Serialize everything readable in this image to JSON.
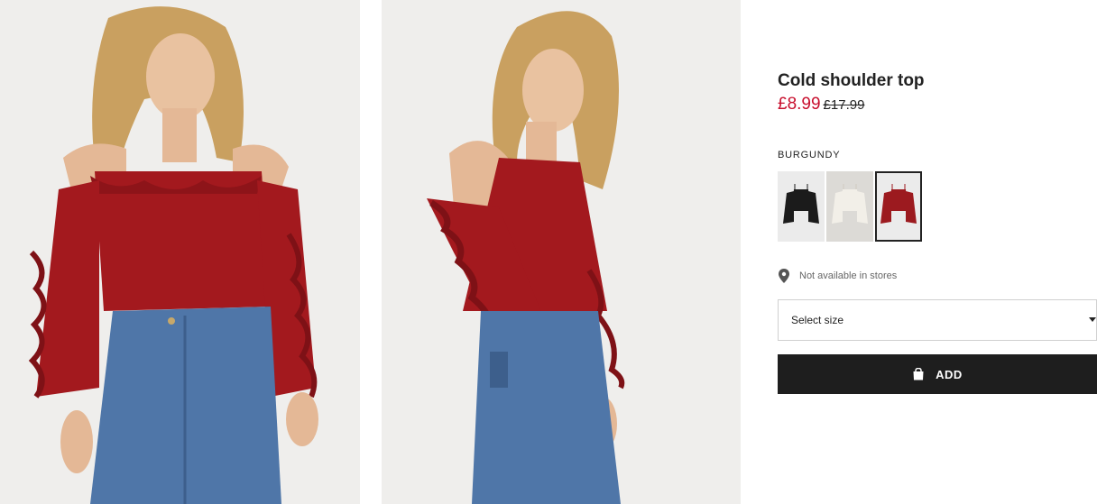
{
  "gallery": {
    "images": [
      {
        "icon": "model-front-photo"
      },
      {
        "icon": "model-side-photo"
      }
    ]
  },
  "product": {
    "title": "Cold shoulder top",
    "price_sale": "£8.99",
    "price_original": "£17.99",
    "color_name": "BURGUNDY",
    "swatches": [
      {
        "icon": "black-top-swatch",
        "color": "#1b1b1b"
      },
      {
        "icon": "white-top-swatch",
        "color": "#f2efe8"
      },
      {
        "icon": "burgundy-top-swatch",
        "color": "#9c1a1f",
        "selected": true
      }
    ],
    "availability": {
      "icon": "location-pin-icon",
      "text": "Not available in stores"
    },
    "size_select": {
      "label": "Select size",
      "icon": "caret-down-icon"
    },
    "add_button": {
      "label": "ADD",
      "icon": "shopping-bag-icon"
    }
  },
  "colors": {
    "sale": "#c8102e",
    "button_bg": "#1e1e1e",
    "top": "#a3191e",
    "denim": "#4f76a8"
  }
}
